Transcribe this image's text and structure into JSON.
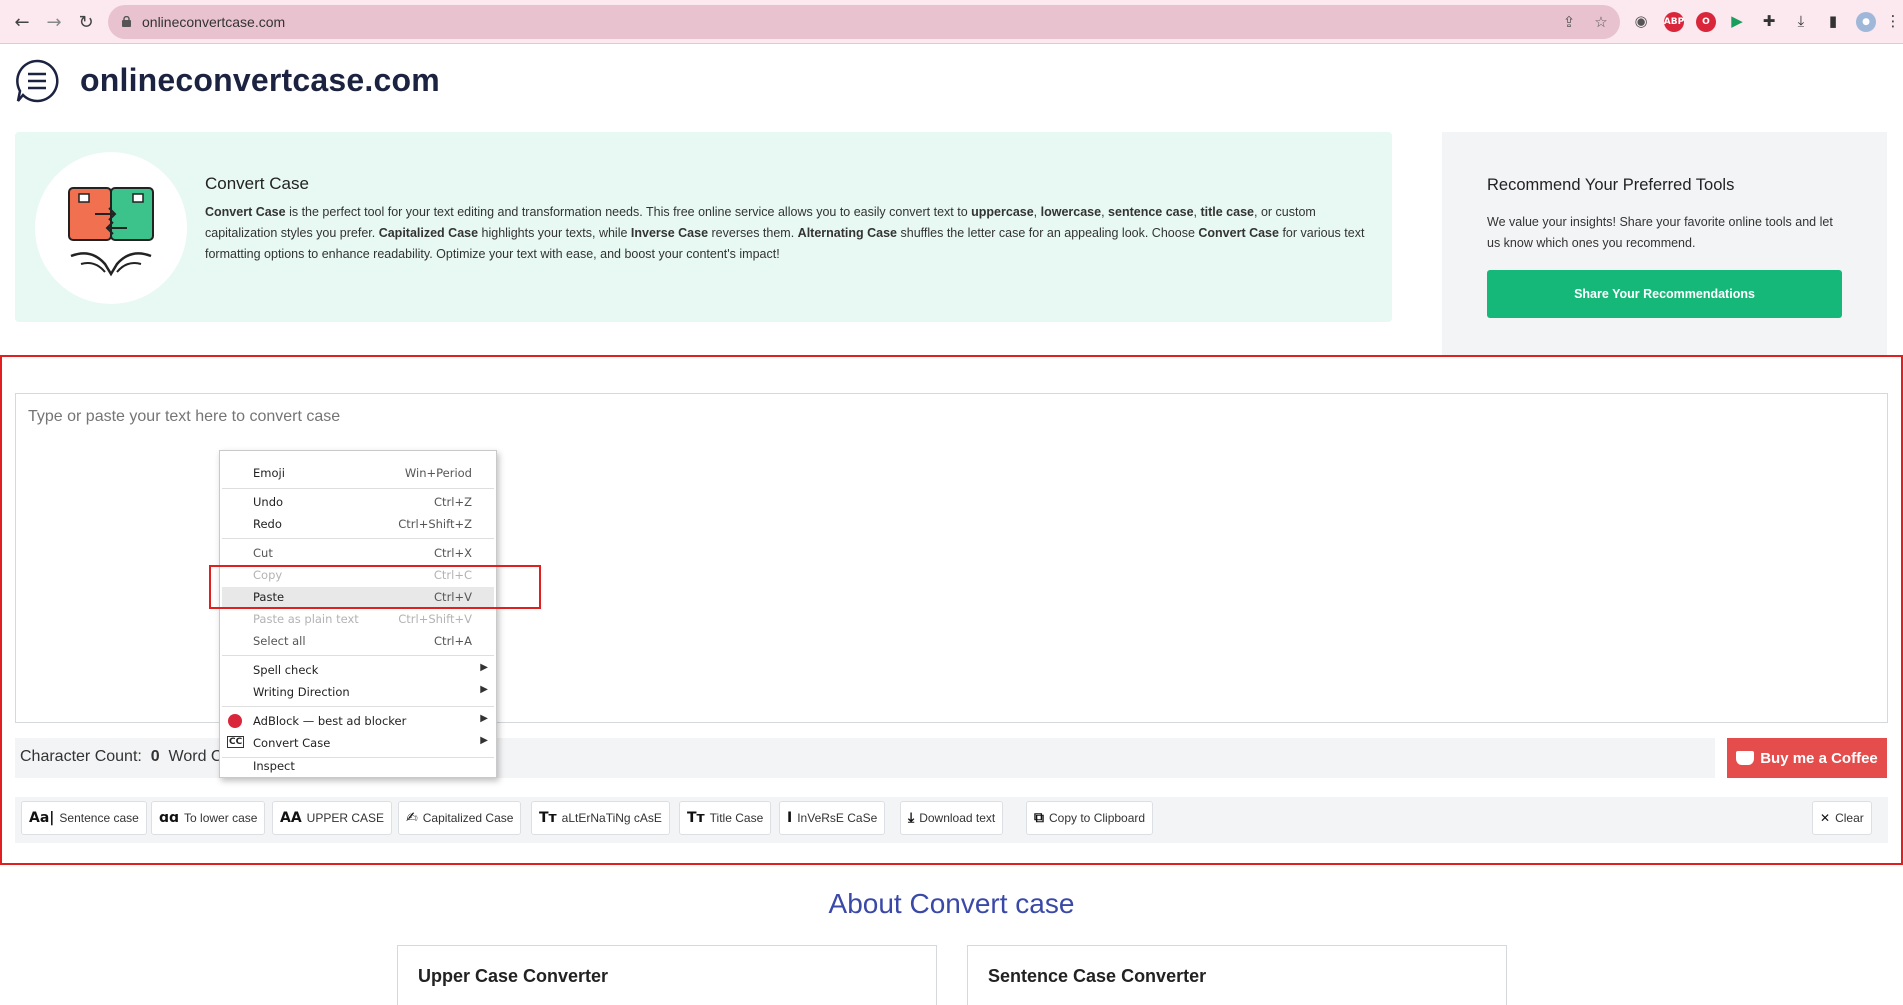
{
  "browser": {
    "url": "onlineconvertcase.com",
    "back_icon": "arrow-left-icon",
    "forward_icon": "arrow-right-icon",
    "reload_icon": "reload-icon",
    "extensions": [
      "camera-icon",
      "adblock-plus-icon",
      "opera-icon",
      "play-icon",
      "puzzle-icon",
      "download-icon",
      "sidebar-icon",
      "profile-icon",
      "menu-dots-icon"
    ],
    "abp_label": "ABP"
  },
  "site": {
    "title": "onlineconvertcase.com",
    "menu_icon": "chat-menu-icon"
  },
  "banner": {
    "title": "Convert Case",
    "p1_b": "Convert Case",
    "p1": " is the perfect tool for your text editing and transformation needs. This free online service allows you to easily convert text to ",
    "uppercase": "uppercase",
    "comma1": ", ",
    "lowercase": "lowercase",
    "comma2": ", ",
    "sentence": "sentence case",
    "comma3": ", ",
    "titlecase": "title case",
    "p2": ", or custom capitalization styles you prefer. ",
    "capitalized": "Capitalized Case",
    "p3": " highlights your texts, while ",
    "inverse": "Inverse Case",
    "p4": " reverses them. ",
    "alternating": "Alternating Case",
    "p5": " shuffles the letter case for an appealing look. Choose ",
    "convert2": "Convert Case",
    "p6": " for various text formatting options to enhance readability. Optimize your text with ease, and boost your content's impact!"
  },
  "sidebar": {
    "title": "Recommend Your Preferred Tools",
    "text": "We value your insights! Share your favorite online tools and let us know which ones you recommend.",
    "button": "Share Your Recommendations"
  },
  "editor": {
    "placeholder": "Type or paste your text here to convert case",
    "char_label": "Character Count:",
    "char_value": "0",
    "word_label": "Word C",
    "coffee": "Buy me a Coffee"
  },
  "tools": [
    {
      "icon": "Aa|",
      "label": "Sentence case"
    },
    {
      "icon": "ɑɑ",
      "label": "To lower case"
    },
    {
      "icon": "AA",
      "label": "UPPER CASE"
    },
    {
      "icon": "✍",
      "label": "Capitalized Case"
    },
    {
      "icon": "Tт",
      "label": "aLtErNaTiNg cAsE"
    },
    {
      "icon": "Tт",
      "label": "Title Case"
    },
    {
      "icon": "I",
      "label": "InVeRsE CaSe"
    },
    {
      "icon": "⤓",
      "label": "Download text"
    },
    {
      "icon": "⧉",
      "label": "Copy to Clipboard"
    },
    {
      "icon": "✕",
      "label": "Clear"
    }
  ],
  "context_menu": {
    "emoji": {
      "label": "Emoji",
      "shortcut": "Win+Period"
    },
    "undo": {
      "label": "Undo",
      "shortcut": "Ctrl+Z"
    },
    "redo": {
      "label": "Redo",
      "shortcut": "Ctrl+Shift+Z"
    },
    "cut": {
      "label": "Cut",
      "shortcut": "Ctrl+X"
    },
    "copy": {
      "label": "Copy",
      "shortcut": "Ctrl+C"
    },
    "paste": {
      "label": "Paste",
      "shortcut": "Ctrl+V"
    },
    "paste_plain": {
      "label": "Paste as plain text",
      "shortcut": "Ctrl+Shift+V"
    },
    "select_all": {
      "label": "Select all",
      "shortcut": "Ctrl+A"
    },
    "spell": {
      "label": "Spell check"
    },
    "writing": {
      "label": "Writing Direction"
    },
    "adblock": {
      "label": "AdBlock — best ad blocker"
    },
    "convert": {
      "label": "Convert Case",
      "badge": "CC"
    },
    "inspect": {
      "label": "Inspect"
    }
  },
  "about": {
    "title": "About Convert case",
    "cards": [
      "Upper Case Converter",
      "Sentence Case Converter"
    ]
  },
  "colors": {
    "accent_green": "#16b87a",
    "highlight_red": "#e0201f",
    "coffee_red": "#e54d4d",
    "heading_blue": "#3a49a8",
    "banner_bg": "#e8f8f3"
  }
}
